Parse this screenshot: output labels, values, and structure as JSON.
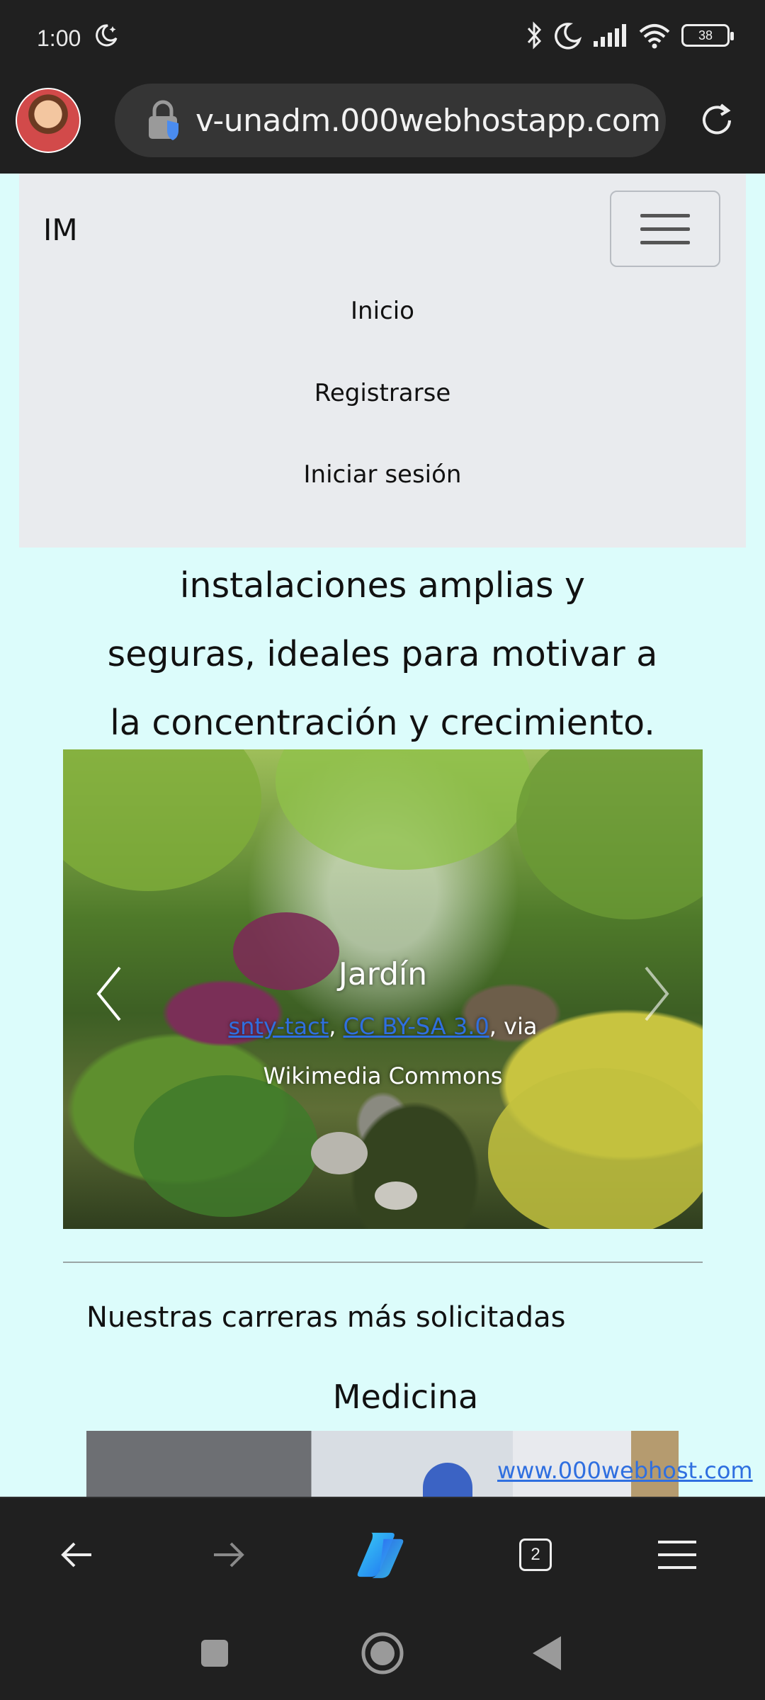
{
  "status_bar": {
    "time": "1:00",
    "battery": "38",
    "icons": [
      "night-mode-icon",
      "bluetooth-icon",
      "do-not-disturb-icon",
      "signal-icon",
      "wifi-icon",
      "battery-icon"
    ]
  },
  "browser": {
    "url": "v-unadm.000webhostapp.com",
    "tab_count": "2",
    "icons": [
      "avatar",
      "lock-icon",
      "reload-icon",
      "back-icon",
      "forward-icon",
      "copilot-icon",
      "menu-icon"
    ]
  },
  "navbar": {
    "brand": "IM",
    "items": [
      {
        "label": "Inicio"
      },
      {
        "label": "Registrarse"
      },
      {
        "label": "Iniciar sesión"
      }
    ]
  },
  "hero": {
    "lines": [
      "instalaciones amplias y",
      "seguras, ideales para motivar a",
      "la concentración y crecimiento."
    ]
  },
  "carousel": {
    "caption_title": "Jardín",
    "credit_author": "snty-tact",
    "credit_sep": ", ",
    "credit_license": "CC BY-SA 3.0",
    "credit_via": ", via",
    "credit_source": "Wikimedia Commons"
  },
  "careers": {
    "section_title": "Nuestras carreras más solicitadas",
    "first_title": "Medicina",
    "watermark": "www.000webhost.com"
  },
  "colors": {
    "page_background": "#dcfcfb",
    "navbar_background": "#e9ebee",
    "browser_chrome": "#202020",
    "link": "#2f6fe0"
  }
}
